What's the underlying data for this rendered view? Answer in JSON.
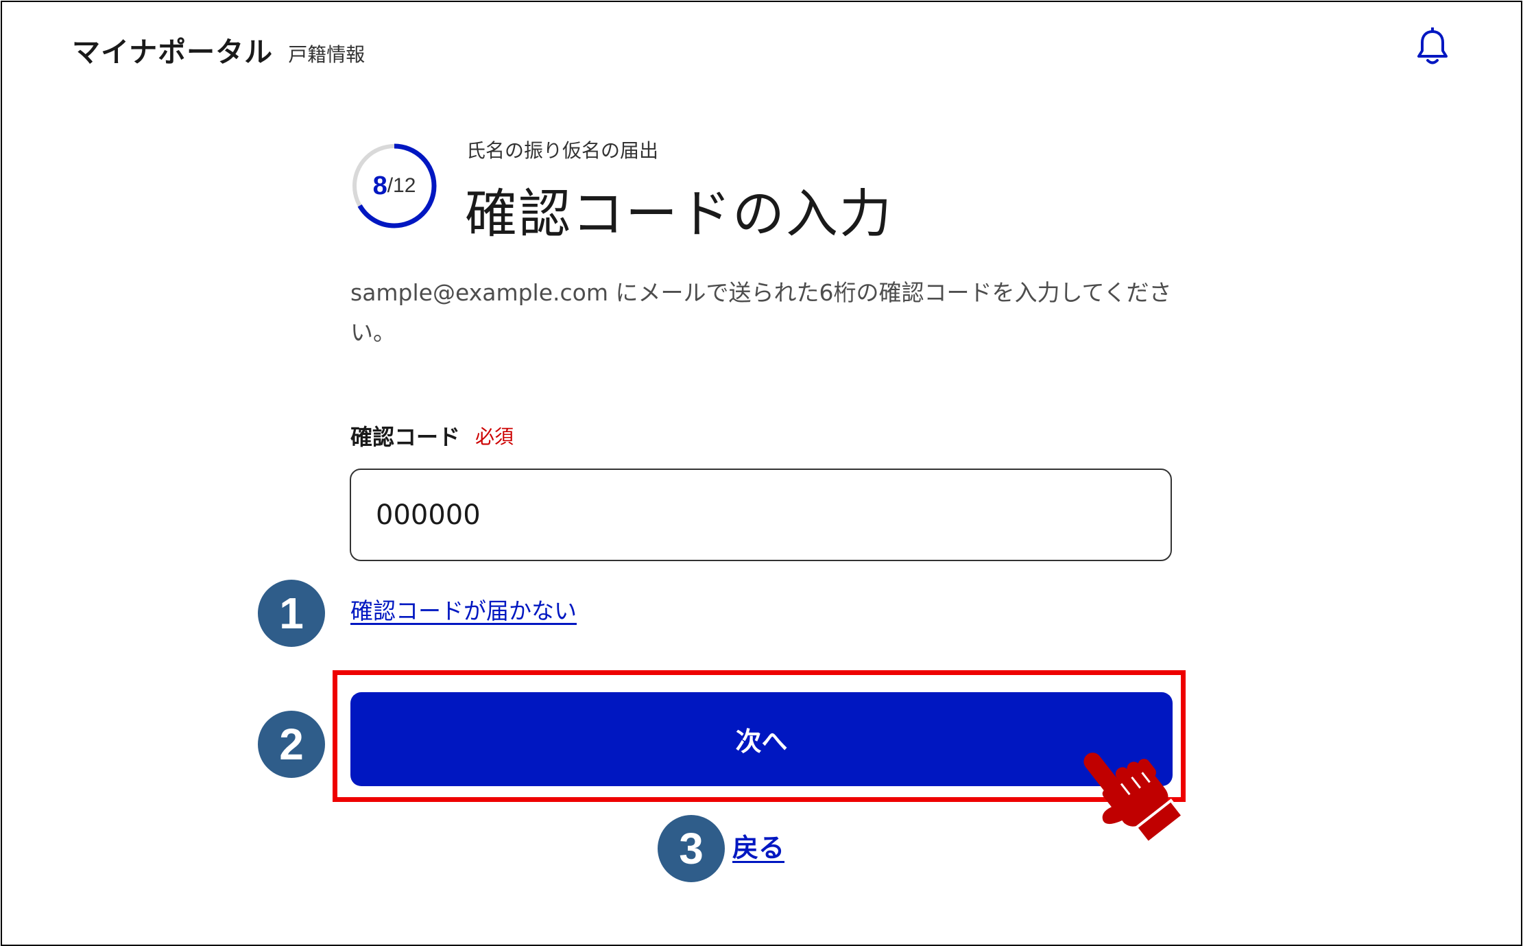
{
  "header": {
    "app_title": "マイナポータル",
    "app_subtitle": "戸籍情報",
    "bell_icon": "bell-icon"
  },
  "progress": {
    "current": "8",
    "total": "/12",
    "fraction": 0.6667
  },
  "form": {
    "step_label": "氏名の振り仮名の届出",
    "title": "確認コードの入力",
    "description": "sample@example.com にメールで送られた6桁の確認コードを入力してください。",
    "field_label": "確認コード",
    "required_badge": "必須",
    "code_value": "000000",
    "no_code_link": "確認コードが届かない",
    "next_button": "次へ",
    "back_link": "戻る"
  },
  "annotations": {
    "marker_1": "1",
    "marker_2": "2",
    "marker_3": "3",
    "pointer_icon": "pointing-hand-icon"
  },
  "colors": {
    "accent": "#0017c1",
    "highlight": "#ee0000",
    "marker": "#2f5d8a",
    "required": "#cc0000"
  }
}
